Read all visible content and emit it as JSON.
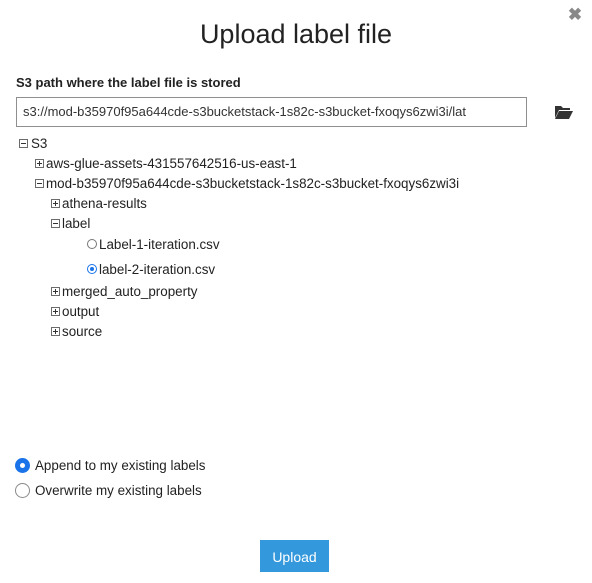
{
  "dialog": {
    "title": "Upload label file",
    "close_icon": "close-icon"
  },
  "path": {
    "label": "S3 path where the label file is stored",
    "value": "s3://mod-b35970f95a644cde-s3bucketstack-1s82c-s3bucket-fxoqys6zwi3i/lat",
    "browse_icon": "folder-open-icon"
  },
  "tree": {
    "root": "S3",
    "bucket_1": "aws-glue-assets-431557642516-us-east-1",
    "bucket_2": "mod-b35970f95a644cde-s3bucketstack-1s82c-s3bucket-fxoqys6zwi3i",
    "folders": {
      "athena_results": "athena-results",
      "label": "label",
      "merged_auto_property": "merged_auto_property",
      "output": "output",
      "source": "source"
    },
    "files": {
      "file_1": "Label-1-iteration.csv",
      "file_2": "label-2-iteration.csv",
      "selected": "label-2-iteration.csv"
    }
  },
  "options": {
    "append": "Append to my existing labels",
    "overwrite": "Overwrite my existing labels",
    "selected": "append"
  },
  "actions": {
    "upload": "Upload"
  }
}
